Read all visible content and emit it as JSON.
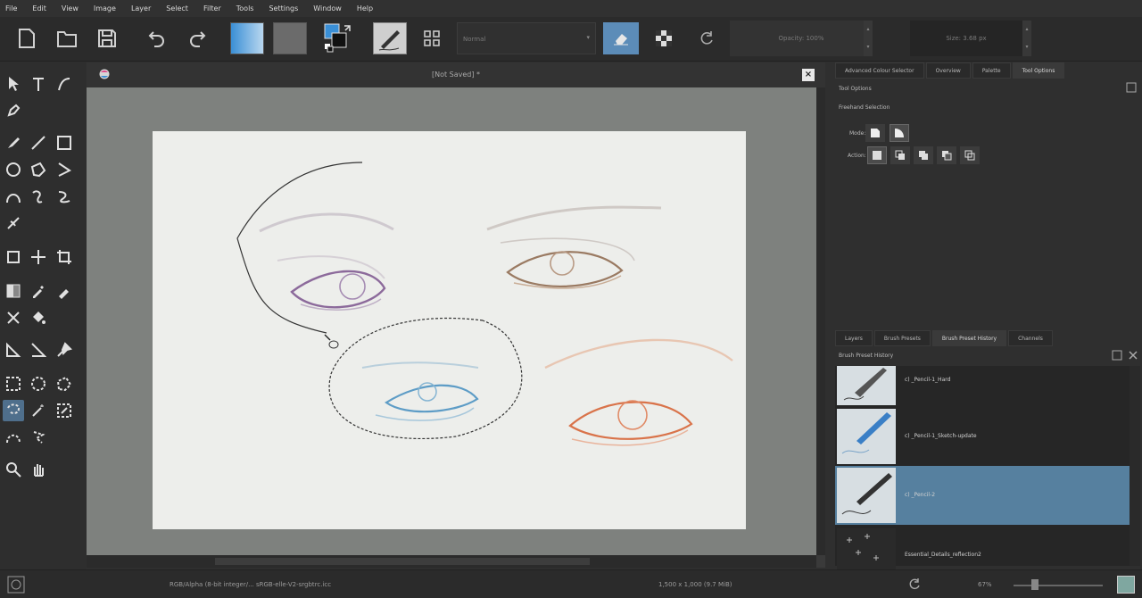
{
  "menu": [
    "File",
    "Edit",
    "View",
    "Image",
    "Layer",
    "Select",
    "Filter",
    "Tools",
    "Settings",
    "Window",
    "Help"
  ],
  "toolbar": {
    "blend_mode": "Normal",
    "opacity": "Opacity: 100%",
    "size": "Size: 3.68 px"
  },
  "document": {
    "title": "[Not Saved]  *",
    "close": "×"
  },
  "dock": {
    "top_tabs": [
      "Advanced Colour Selector",
      "Overview",
      "Palette",
      "Tool Options"
    ],
    "tool_options_title": "Tool Options",
    "section": "Freehand Selection",
    "mode_label": "Mode:",
    "action_label": "Action:",
    "bottom_tabs": [
      "Layers",
      "Brush Presets",
      "Brush Preset History",
      "Channels"
    ],
    "history_title": "Brush Preset History",
    "history": [
      {
        "name": "c) _Pencil-1_Hard"
      },
      {
        "name": "c) _Pencil-1_Sketch-update"
      },
      {
        "name": "c) _Pencil-2"
      },
      {
        "name": "Essential_Details_reflection2"
      }
    ]
  },
  "status": {
    "colorspace": "RGB/Alpha (8-bit integer/... sRGB-elle-V2-srgbtrc.icc",
    "dimensions": "1,500 x 1,000 (9.7 MiB)",
    "zoom": "67%"
  },
  "colors": {
    "accent": "#56809f",
    "canvas_bg": "#7e817e",
    "paper": "#edeeeb"
  }
}
